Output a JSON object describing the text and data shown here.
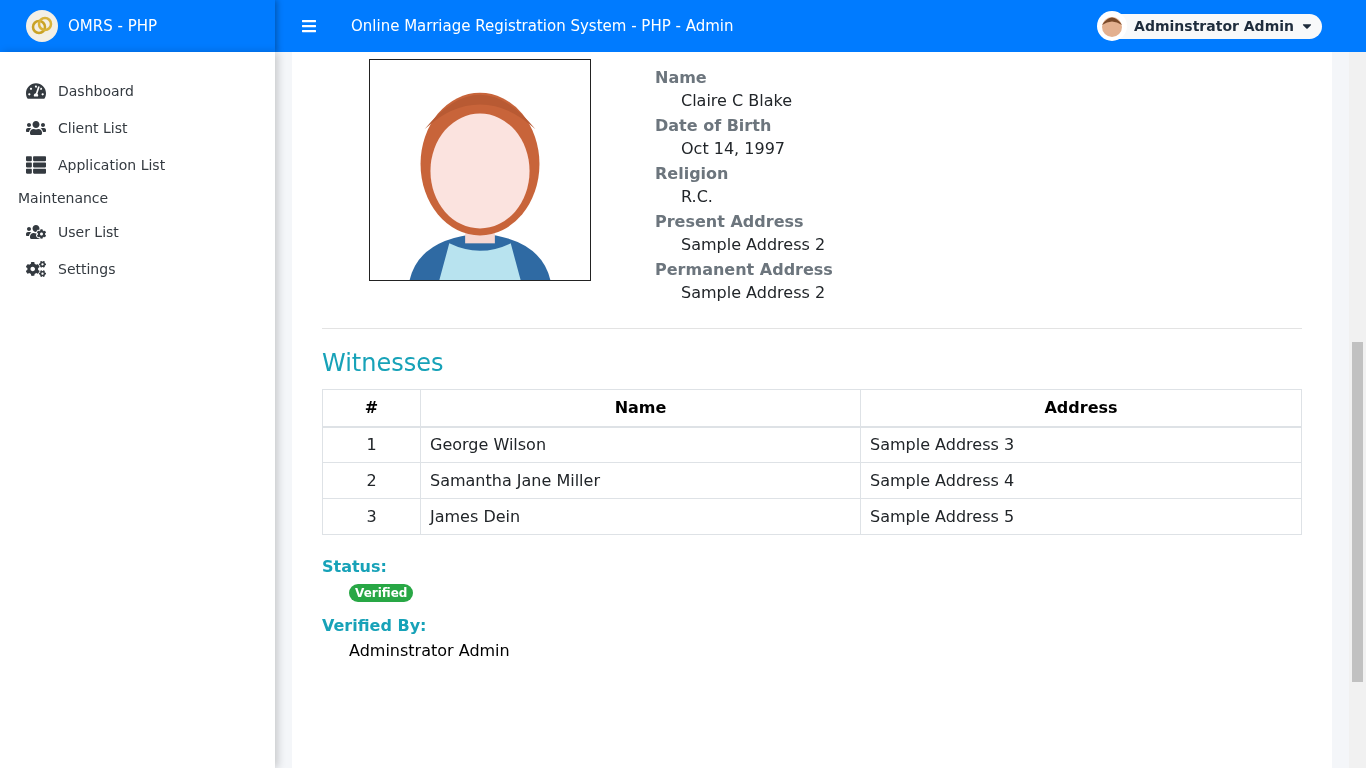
{
  "brand": {
    "title": "OMRS - PHP"
  },
  "topbar": {
    "title": "Online Marriage Registration System - PHP - Admin",
    "user": "Adminstrator Admin"
  },
  "sidebar": {
    "items": [
      {
        "kind": "link",
        "label": "Dashboard"
      },
      {
        "kind": "link",
        "label": "Client List"
      },
      {
        "kind": "link",
        "label": "Application List"
      },
      {
        "kind": "header",
        "label": "Maintenance"
      },
      {
        "kind": "link",
        "label": "User List"
      },
      {
        "kind": "link",
        "label": "Settings"
      }
    ]
  },
  "profile": {
    "fields": [
      {
        "label": "Name",
        "value": "Claire C Blake"
      },
      {
        "label": "Date of Birth",
        "value": "Oct 14, 1997"
      },
      {
        "label": "Religion",
        "value": "R.C."
      },
      {
        "label": "Present Address",
        "value": "Sample Address 2"
      },
      {
        "label": "Permanent Address",
        "value": "Sample Address 2"
      }
    ]
  },
  "witnesses": {
    "title": "Witnesses",
    "columns": [
      "#",
      "Name",
      "Address"
    ],
    "rows": [
      [
        "1",
        "George Wilson",
        "Sample Address 3"
      ],
      [
        "2",
        "Samantha Jane Miller",
        "Sample Address 4"
      ],
      [
        "3",
        "James Dein",
        "Sample Address 5"
      ]
    ]
  },
  "status": {
    "label": "Status:",
    "badge": "Verified",
    "color": "#28a745"
  },
  "verified_by": {
    "label": "Verified By:",
    "value": "Adminstrator Admin"
  }
}
